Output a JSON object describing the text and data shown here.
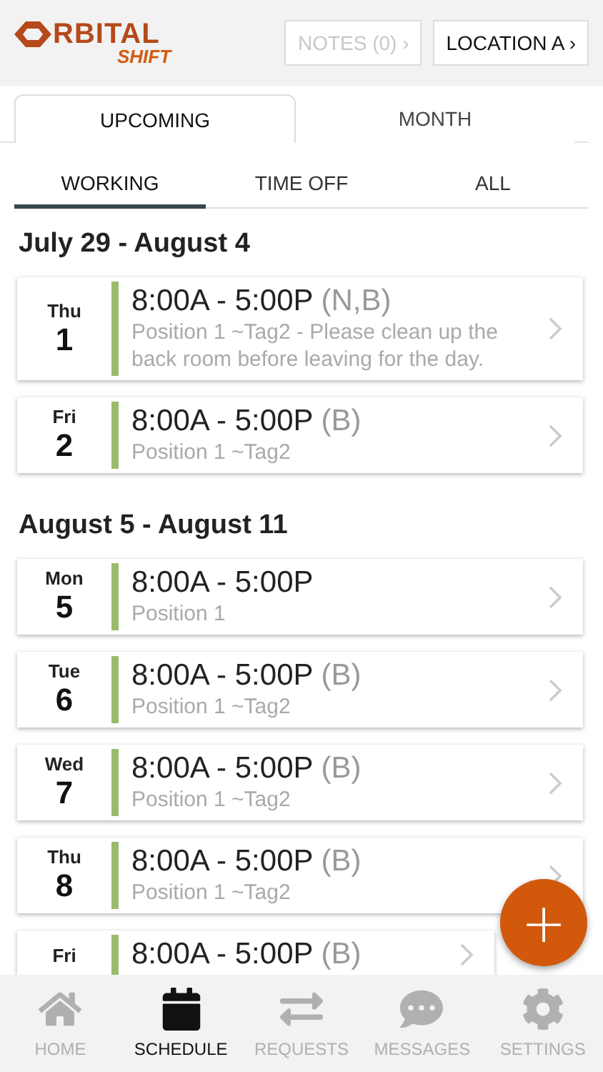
{
  "header": {
    "logo": {
      "main": "RBITAL",
      "sub": "SHIFT"
    },
    "notes_button": {
      "label": "NOTES (0) ›",
      "disabled": true
    },
    "location_button": {
      "label": "LOCATION A ›",
      "disabled": false
    }
  },
  "view_tabs": [
    {
      "label": "UPCOMING",
      "selected": true
    },
    {
      "label": "MONTH",
      "selected": false
    }
  ],
  "filter_tabs": [
    {
      "label": "WORKING",
      "selected": true
    },
    {
      "label": "TIME OFF",
      "selected": false
    },
    {
      "label": "ALL",
      "selected": false
    }
  ],
  "weeks": [
    {
      "title": "July 29 - August 4",
      "shifts": [
        {
          "day": "Thu",
          "date": "1",
          "time": "8:00A - 5:00P",
          "tags": "(N,B)",
          "detail": "Position 1 ~Tag2 - Please clean up the back room before leaving for the day.",
          "color": "#9bbb6c"
        },
        {
          "day": "Fri",
          "date": "2",
          "time": "8:00A - 5:00P",
          "tags": "(B)",
          "detail": "Position 1 ~Tag2",
          "color": "#9bbb6c"
        }
      ]
    },
    {
      "title": "August 5 - August 11",
      "shifts": [
        {
          "day": "Mon",
          "date": "5",
          "time": "8:00A - 5:00P",
          "detail": "Position 1",
          "color": "#9bbb6c"
        },
        {
          "day": "Tue",
          "date": "6",
          "time": "8:00A - 5:00P",
          "tags": "(B)",
          "detail": "Position 1 ~Tag2",
          "color": "#9bbb6c"
        },
        {
          "day": "Wed",
          "date": "7",
          "time": "8:00A - 5:00P",
          "tags": "(B)",
          "detail": "Position 1 ~Tag2",
          "color": "#9bbb6c"
        },
        {
          "day": "Thu",
          "date": "8",
          "time": "8:00A - 5:00P",
          "tags": "(B)",
          "detail": "Position 1 ~Tag2",
          "color": "#9bbb6c"
        },
        {
          "day": "Fri",
          "time": "8:00A - 5:00P",
          "tags": "(B)",
          "color": "#9bbb6c"
        }
      ]
    }
  ],
  "fab": {
    "label": "+"
  },
  "nav": [
    {
      "label": "HOME",
      "selected": false
    },
    {
      "label": "SCHEDULE",
      "selected": true
    },
    {
      "label": "REQUESTS",
      "selected": false
    },
    {
      "label": "MESSAGES",
      "selected": false
    },
    {
      "label": "SETTINGS",
      "selected": false
    }
  ]
}
